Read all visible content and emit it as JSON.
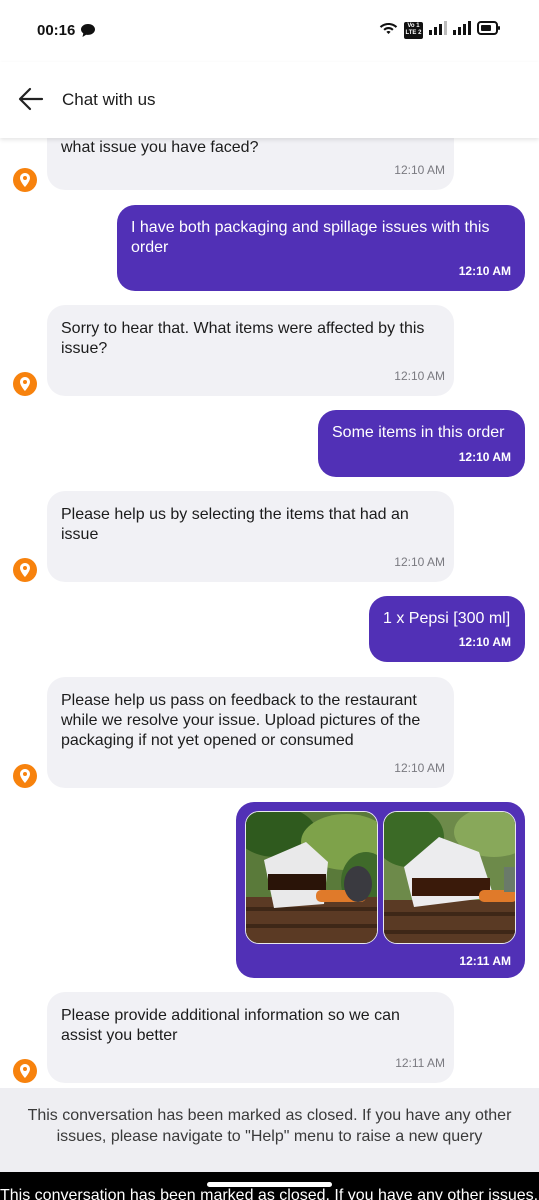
{
  "status_bar": {
    "time": "00:16",
    "icons": [
      "chat-bubble-icon",
      "wifi-icon",
      "lte-icon",
      "signal-icon",
      "signal-icon",
      "battery-icon"
    ],
    "lte_top": "Vo 1",
    "lte_bottom": "LTE 2"
  },
  "header": {
    "back_icon": "arrow-left-icon",
    "title": "Chat with us"
  },
  "colors": {
    "brand_purple": "#5130b6",
    "bot_bubble": "#f1f1f5",
    "avatar_orange": "#f7820d",
    "banner_bg": "#eeeef2"
  },
  "messages": [
    {
      "sender": "bot",
      "text": "what issue you have faced?",
      "time": "12:10 AM"
    },
    {
      "sender": "user",
      "text": "I have both packaging and spillage issues with this order",
      "time": "12:10 AM"
    },
    {
      "sender": "bot",
      "text": "Sorry to hear that. What items were affected by this issue?",
      "time": "12:10 AM"
    },
    {
      "sender": "user",
      "text": "Some items in this order",
      "time": "12:10 AM"
    },
    {
      "sender": "bot",
      "text": "Please help us by selecting the items that had an issue",
      "time": "12:10 AM"
    },
    {
      "sender": "user",
      "text": "1 x Pepsi [300 ml]",
      "time": "12:10 AM"
    },
    {
      "sender": "bot",
      "text": "Please help us pass on feedback to the restaurant while we resolve your issue. Upload pictures of the packaging if not yet opened or consumed",
      "time": "12:10 AM"
    },
    {
      "sender": "user",
      "type": "images",
      "image_count": 2,
      "time": "12:11 AM"
    },
    {
      "sender": "bot",
      "text": "Please provide additional information so we can assist you better",
      "time": "12:11 AM"
    }
  ],
  "closed_banner": "This conversation has been marked as closed. If you have any other issues, please navigate to \"Help\" menu to raise a new query"
}
